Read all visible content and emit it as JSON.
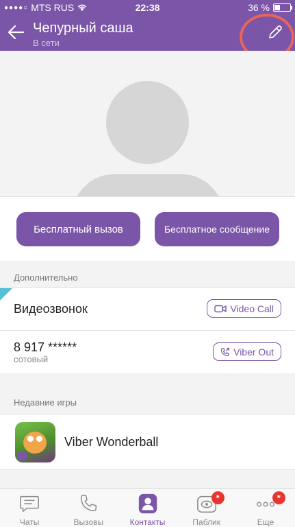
{
  "status_bar": {
    "carrier": "MTS RUS",
    "time": "22:38",
    "battery_text": "36 %",
    "battery_level": 0.36
  },
  "header": {
    "title": "Чепурный саша",
    "subtitle": "В сети"
  },
  "actions": {
    "call_label": "Бесплатный вызов",
    "message_label": "Бесплатное сообщение"
  },
  "details": {
    "section_title": "Дополнительно",
    "video_label": "Видеозвонок",
    "video_button": "Video Call",
    "phone_number": "8 917 ******",
    "phone_type": "сотовый",
    "viber_out_button": "Viber Out"
  },
  "games": {
    "section_title": "Недавние игры",
    "items": [
      {
        "name": "Viber Wonderball"
      }
    ]
  },
  "tabs": [
    {
      "label": "Чаты",
      "icon": "chat-icon",
      "active": false
    },
    {
      "label": "Вызовы",
      "icon": "phone-icon",
      "active": false
    },
    {
      "label": "Контакты",
      "icon": "contacts-icon",
      "active": true
    },
    {
      "label": "Паблик",
      "icon": "public-icon",
      "active": false,
      "badge": "*"
    },
    {
      "label": "Еще",
      "icon": "more-icon",
      "active": false,
      "badge": "*"
    }
  ],
  "colors": {
    "brand": "#7b55a8",
    "badge": "#e8352f",
    "highlight_ring": "#e8655a"
  }
}
